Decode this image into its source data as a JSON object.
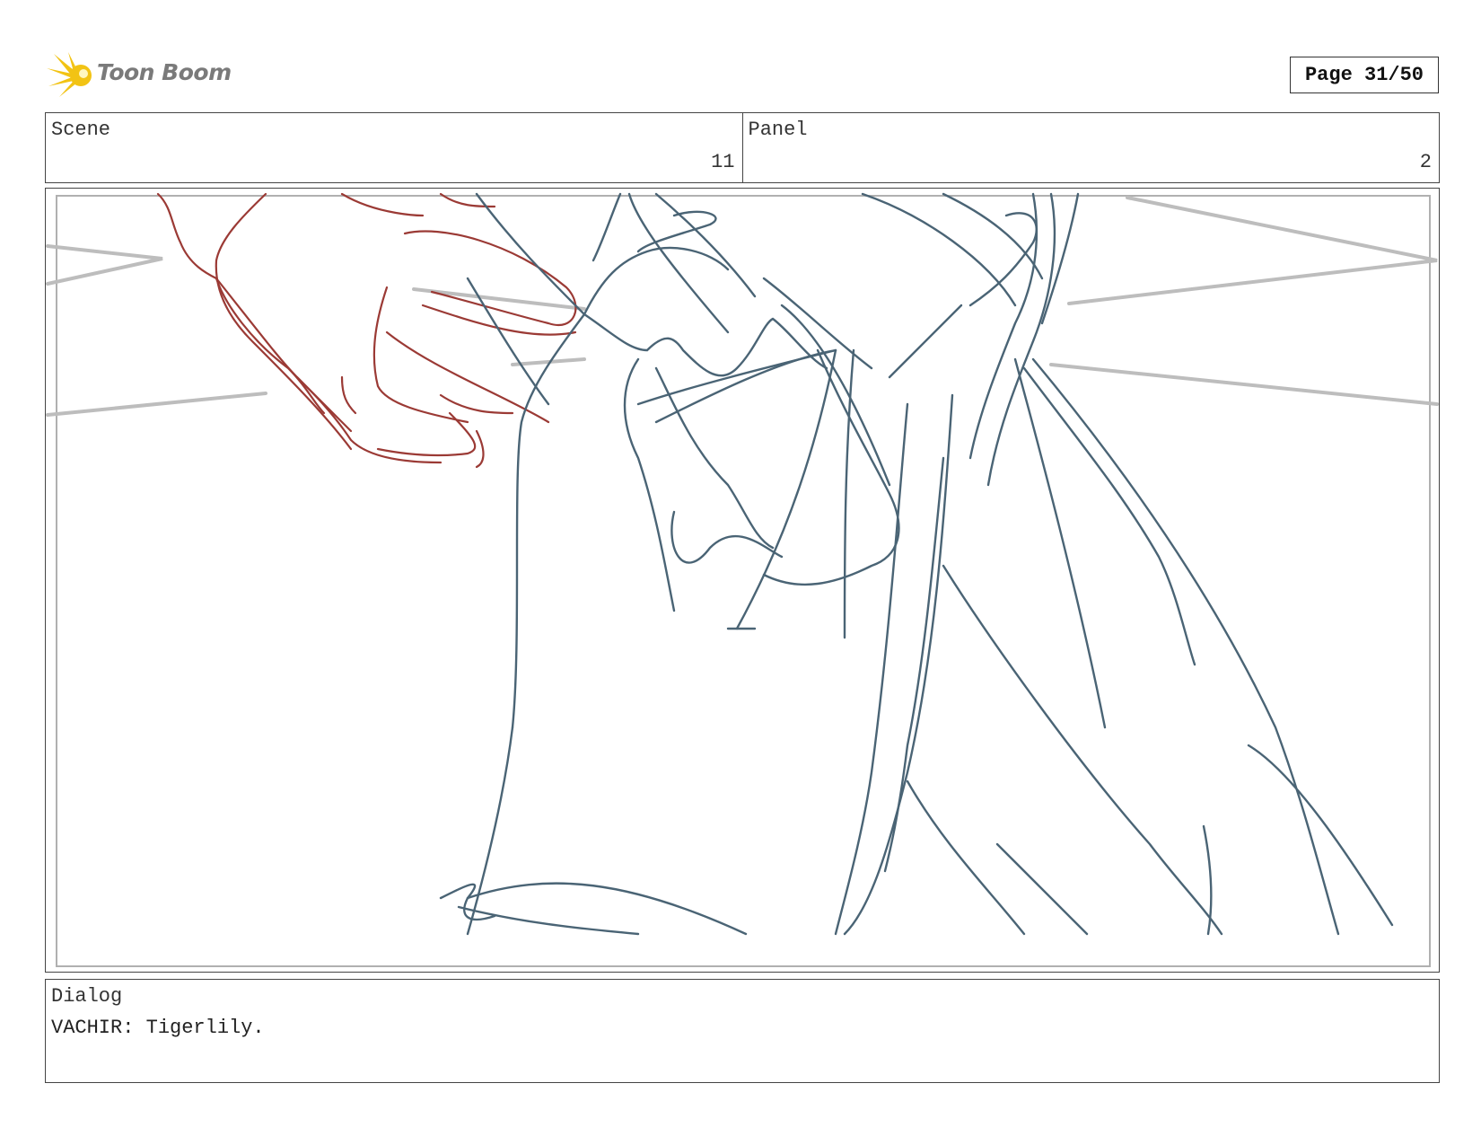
{
  "header": {
    "brand": "Toon Boom",
    "page_label": "Page 31/50"
  },
  "info": {
    "scene_label": "Scene",
    "scene_value": "11",
    "panel_label": "Panel",
    "panel_value": "2"
  },
  "dialog": {
    "label": "Dialog",
    "text": "VACHIR: Tigerlily."
  },
  "colors": {
    "sketch_blue": "#4a6475",
    "sketch_red": "#9b3a35",
    "guide_gray": "#bdbdbd",
    "logo_yellow": "#f2c314"
  }
}
